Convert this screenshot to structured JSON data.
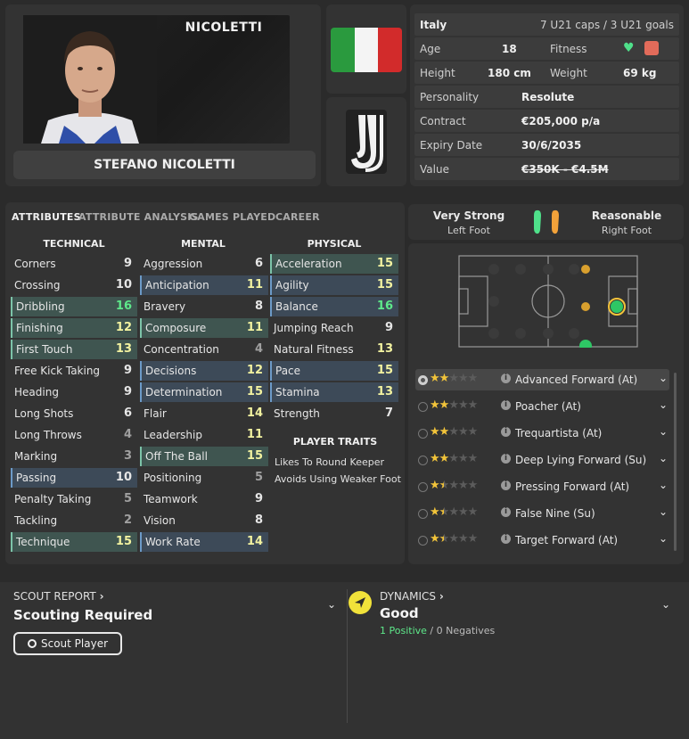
{
  "player": {
    "surname": "NICOLETTI",
    "full_name": "STEFANO NICOLETTI"
  },
  "flag_colors": [
    "#2a9a3e",
    "#f4f4f4",
    "#d22b2b"
  ],
  "info": {
    "nation": "Italy",
    "caps": "7 U21 caps / 3 U21 goals",
    "age_label": "Age",
    "age": "18",
    "fitness_label": "Fitness",
    "height_label": "Height",
    "height": "180 cm",
    "weight_label": "Weight",
    "weight": "69 kg",
    "personality_label": "Personality",
    "personality": "Resolute",
    "contract_label": "Contract",
    "contract": "€205,000 p/a",
    "expiry_label": "Expiry Date",
    "expiry": "30/6/2035",
    "value_label": "Value",
    "value": "€350K - €4.5M"
  },
  "tabs": [
    "ATTRIBUTES",
    "ATTRIBUTE ANALYSIS",
    "GAMES PLAYED",
    "CAREER"
  ],
  "columns": {
    "technical_title": "TECHNICAL",
    "mental_title": "MENTAL",
    "physical_title": "PHYSICAL"
  },
  "technical": [
    {
      "name": "Corners",
      "value": "9"
    },
    {
      "name": "Crossing",
      "value": "10"
    },
    {
      "name": "Dribbling",
      "value": "16"
    },
    {
      "name": "Finishing",
      "value": "12"
    },
    {
      "name": "First Touch",
      "value": "13"
    },
    {
      "name": "Free Kick Taking",
      "value": "9"
    },
    {
      "name": "Heading",
      "value": "9"
    },
    {
      "name": "Long Shots",
      "value": "6"
    },
    {
      "name": "Long Throws",
      "value": "4"
    },
    {
      "name": "Marking",
      "value": "3"
    },
    {
      "name": "Passing",
      "value": "10"
    },
    {
      "name": "Penalty Taking",
      "value": "5"
    },
    {
      "name": "Tackling",
      "value": "2"
    },
    {
      "name": "Technique",
      "value": "15"
    }
  ],
  "mental": [
    {
      "name": "Aggression",
      "value": "6"
    },
    {
      "name": "Anticipation",
      "value": "11"
    },
    {
      "name": "Bravery",
      "value": "8"
    },
    {
      "name": "Composure",
      "value": "11"
    },
    {
      "name": "Concentration",
      "value": "4"
    },
    {
      "name": "Decisions",
      "value": "12"
    },
    {
      "name": "Determination",
      "value": "15"
    },
    {
      "name": "Flair",
      "value": "14"
    },
    {
      "name": "Leadership",
      "value": "11"
    },
    {
      "name": "Off The Ball",
      "value": "15"
    },
    {
      "name": "Positioning",
      "value": "5"
    },
    {
      "name": "Teamwork",
      "value": "9"
    },
    {
      "name": "Vision",
      "value": "8"
    },
    {
      "name": "Work Rate",
      "value": "14"
    }
  ],
  "physical": [
    {
      "name": "Acceleration",
      "value": "15"
    },
    {
      "name": "Agility",
      "value": "15"
    },
    {
      "name": "Balance",
      "value": "16"
    },
    {
      "name": "Jumping Reach",
      "value": "9"
    },
    {
      "name": "Natural Fitness",
      "value": "13"
    },
    {
      "name": "Pace",
      "value": "15"
    },
    {
      "name": "Stamina",
      "value": "13"
    },
    {
      "name": "Strength",
      "value": "7"
    }
  ],
  "traits": {
    "title": "PLAYER TRAITS",
    "items": [
      "Likes To Round Keeper",
      "Avoids Using Weaker Foot"
    ]
  },
  "feet": {
    "left_rating": "Very Strong",
    "left_label": "Left Foot",
    "right_rating": "Reasonable",
    "right_label": "Right Foot"
  },
  "roles": [
    {
      "name": "Advanced Forward (At)",
      "stars": 2
    },
    {
      "name": "Poacher (At)",
      "stars": 2
    },
    {
      "name": "Trequartista (At)",
      "stars": 2
    },
    {
      "name": "Deep Lying Forward (Su)",
      "stars": 2
    },
    {
      "name": "Pressing Forward (At)",
      "stars": 1.5
    },
    {
      "name": "False Nine (Su)",
      "stars": 1.5
    },
    {
      "name": "Target Forward (At)",
      "stars": 1.5
    }
  ],
  "scout": {
    "link": "SCOUT REPORT",
    "status": "Scouting Required",
    "button": "Scout Player"
  },
  "dynamics": {
    "link": "DYNAMICS",
    "status": "Good",
    "positives": "1 Positive",
    "separator": "/",
    "negatives": "0 Negatives"
  }
}
